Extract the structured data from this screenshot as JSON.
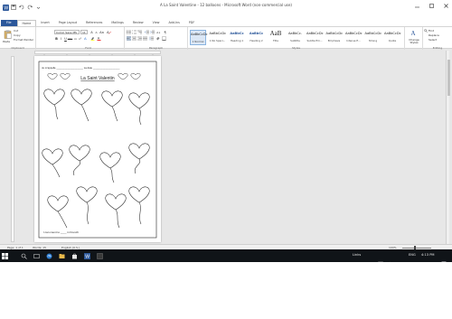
{
  "window": {
    "title": "A La Saint Valentine - 12 balloons - Microsoft Word (non-commercial use)"
  },
  "quick_access": {
    "icons": [
      "word-logo-icon",
      "save-icon",
      "undo-icon",
      "redo-icon",
      "customize-icon"
    ]
  },
  "tabs": [
    {
      "label": "File",
      "state": "file"
    },
    {
      "label": "Home",
      "state": "active"
    },
    {
      "label": "Insert",
      "state": ""
    },
    {
      "label": "Page Layout",
      "state": ""
    },
    {
      "label": "References",
      "state": ""
    },
    {
      "label": "Mailings",
      "state": ""
    },
    {
      "label": "Review",
      "state": ""
    },
    {
      "label": "View",
      "state": ""
    },
    {
      "label": "Add-Ins",
      "state": ""
    },
    {
      "label": "PDF",
      "state": ""
    }
  ],
  "ribbon": {
    "clipboard": {
      "label": "Clipboard",
      "paste": "Paste",
      "cut": "Cut",
      "copy": "Copy",
      "format_painter": "Format Painter"
    },
    "font": {
      "label": "Font",
      "font_name": "Comic Sans MS",
      "font_size": "11"
    },
    "paragraph": {
      "label": "Paragraph"
    },
    "styles": {
      "label": "Styles",
      "items": [
        {
          "sample": "AaBbCcDc",
          "name": "1 Normal",
          "selected": true
        },
        {
          "sample": "AaBbCcDc",
          "name": "1 No Spaci...",
          "selected": false
        },
        {
          "sample": "AaBbCc",
          "name": "Heading 1",
          "selected": false
        },
        {
          "sample": "AaBbCc",
          "name": "Heading 2",
          "selected": false
        },
        {
          "sample": "AaB",
          "name": "Title",
          "selected": false
        },
        {
          "sample": "AaBbCc.",
          "name": "Subtitle",
          "selected": false
        },
        {
          "sample": "AaBbCcDc",
          "name": "Subtle Em...",
          "selected": false
        },
        {
          "sample": "AaBbCcDc",
          "name": "Emphasis",
          "selected": false
        },
        {
          "sample": "AaBbCcDc",
          "name": "Intense E...",
          "selected": false
        },
        {
          "sample": "AaBbCcDc",
          "name": "Strong",
          "selected": false
        },
        {
          "sample": "AaBbCcDc",
          "name": "Quote",
          "selected": false
        }
      ],
      "change_styles": "Change Styles"
    },
    "editing": {
      "label": "Editing",
      "find": "Find",
      "replace": "Replace",
      "select": "Select"
    }
  },
  "worksheet": {
    "name_line": "Je m'appelle ___________________ La date ___________________",
    "title": "La Saint Valentin",
    "footer": "I can count to ____ in French"
  },
  "statusbar": {
    "page": "Page: 1 of 1",
    "words": "Words: 15",
    "language": "English (U.S.)",
    "zoom": "100%"
  },
  "taskbar": {
    "tray_lang": "ENG",
    "time": "4:13 PM",
    "tray_items": "Links"
  },
  "colors": {
    "file_tab": "#2b579a",
    "taskbar": "#101418",
    "workspace": "#e7e7e7"
  }
}
